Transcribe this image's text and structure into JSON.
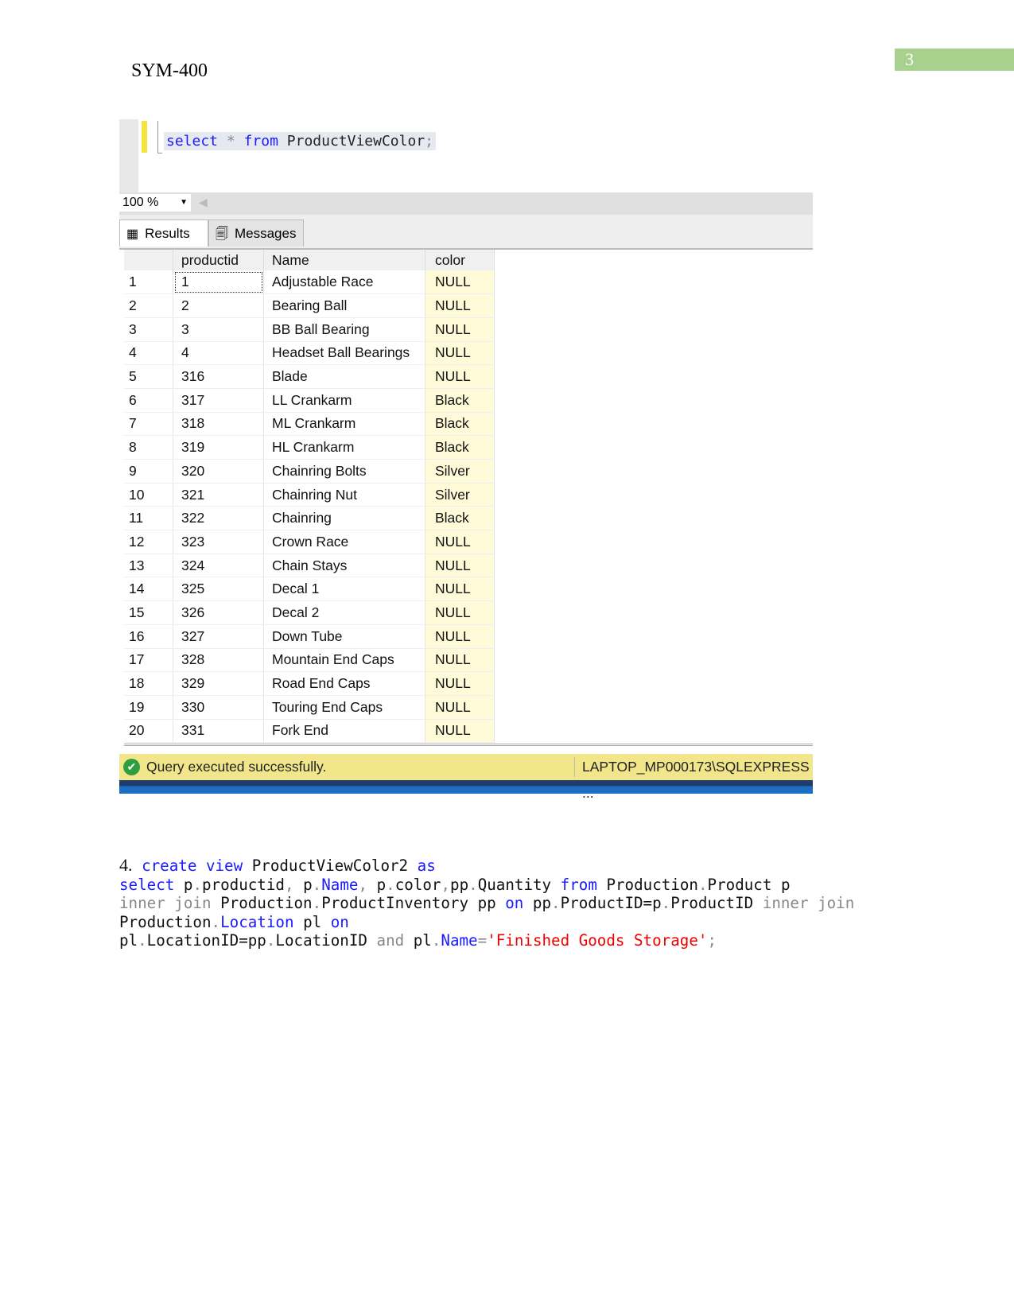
{
  "header": {
    "title": "SYM-400",
    "page_number": "3"
  },
  "editor": {
    "query_parts": {
      "select": "select",
      "star": "*",
      "from": "from",
      "object": "ProductViewColor",
      "semicolon": ";"
    }
  },
  "zoom": {
    "value": "100 %"
  },
  "tabs": [
    {
      "label": "Results",
      "icon": "grid-icon"
    },
    {
      "label": "Messages",
      "icon": "messages-icon"
    }
  ],
  "grid": {
    "columns": [
      "productid",
      "Name",
      "color"
    ],
    "rows": [
      [
        "1",
        "1",
        "Adjustable Race",
        "NULL"
      ],
      [
        "2",
        "2",
        "Bearing Ball",
        "NULL"
      ],
      [
        "3",
        "3",
        "BB Ball Bearing",
        "NULL"
      ],
      [
        "4",
        "4",
        "Headset Ball Bearings",
        "NULL"
      ],
      [
        "5",
        "316",
        "Blade",
        "NULL"
      ],
      [
        "6",
        "317",
        "LL Crankarm",
        "Black"
      ],
      [
        "7",
        "318",
        "ML Crankarm",
        "Black"
      ],
      [
        "8",
        "319",
        "HL Crankarm",
        "Black"
      ],
      [
        "9",
        "320",
        "Chainring Bolts",
        "Silver"
      ],
      [
        "10",
        "321",
        "Chainring Nut",
        "Silver"
      ],
      [
        "11",
        "322",
        "Chainring",
        "Black"
      ],
      [
        "12",
        "323",
        "Crown Race",
        "NULL"
      ],
      [
        "13",
        "324",
        "Chain Stays",
        "NULL"
      ],
      [
        "14",
        "325",
        "Decal 1",
        "NULL"
      ],
      [
        "15",
        "326",
        "Decal 2",
        "NULL"
      ],
      [
        "16",
        "327",
        "Down Tube",
        "NULL"
      ],
      [
        "17",
        "328",
        "Mountain End Caps",
        "NULL"
      ],
      [
        "18",
        "329",
        "Road End Caps",
        "NULL"
      ],
      [
        "19",
        "330",
        "Touring End Caps",
        "NULL"
      ],
      [
        "20",
        "331",
        "Fork End",
        "NULL"
      ]
    ]
  },
  "status": {
    "message": "Query executed successfully.",
    "server": "LAPTOP_MP000173\\SQLEXPRESS ...",
    "icon": "check-circle-icon"
  },
  "code": {
    "number": "4.",
    "t": [
      "create",
      "view",
      "ProductViewColor2",
      "as",
      "select",
      "p",
      "productid",
      ",",
      "Name",
      "color",
      "pp",
      "Quantity",
      "from",
      "Production",
      "Product p",
      "inner join",
      "ProductInventory pp",
      "on",
      "pp",
      "ProductID=p",
      "ProductID",
      "Location",
      "pl",
      "LocationID=pp",
      "LocationID",
      "and",
      "=",
      "'Finished Goods Storage'",
      ";",
      ".",
      " "
    ]
  },
  "colors": {
    "keyword": "#1a1aff",
    "string": "#e00000",
    "operator": "#888888",
    "page_number_bg": "#a9d18e",
    "status_bg": "#f2e68a"
  }
}
